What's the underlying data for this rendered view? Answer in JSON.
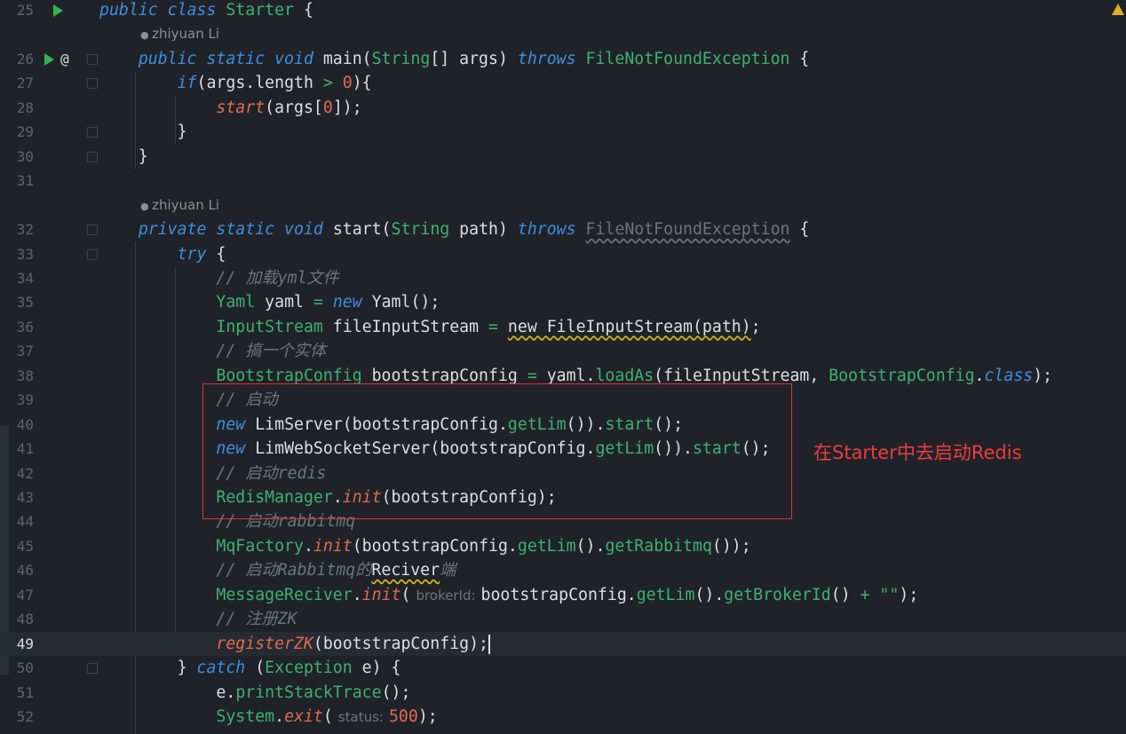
{
  "editor": {
    "author": "zhiyuan Li",
    "annotation": "在Starter中去启动Redis",
    "current_line": "49",
    "rows": [
      {
        "ln": "25",
        "run": true,
        "t": [
          [
            "k",
            "public class "
          ],
          [
            "c",
            "Starter"
          ],
          [
            "p",
            " {"
          ]
        ]
      },
      {
        "author": true
      },
      {
        "ln": "26",
        "run": true,
        "at": true,
        "fold": true,
        "t": [
          [
            "p",
            "    "
          ],
          [
            "k",
            "public static void "
          ],
          [
            "p",
            "main("
          ],
          [
            "c",
            "String"
          ],
          [
            "p",
            "[] args) "
          ],
          [
            "k",
            "throws "
          ],
          [
            "c",
            "FileNotFoundException"
          ],
          [
            "p",
            " {"
          ]
        ]
      },
      {
        "ln": "27",
        "fold": true,
        "t": [
          [
            "p",
            "        "
          ],
          [
            "k",
            "if"
          ],
          [
            "p",
            "(args.length "
          ],
          [
            "o",
            ">"
          ],
          [
            "p",
            " "
          ],
          [
            "n",
            "0"
          ],
          [
            "p",
            "){"
          ]
        ]
      },
      {
        "ln": "28",
        "t": [
          [
            "p",
            "            "
          ],
          [
            "s",
            "start"
          ],
          [
            "p",
            "(args["
          ],
          [
            "n",
            "0"
          ],
          [
            "p",
            "]);"
          ]
        ]
      },
      {
        "ln": "29",
        "fold": true,
        "t": [
          [
            "p",
            "        }"
          ]
        ]
      },
      {
        "ln": "30",
        "fold": true,
        "t": [
          [
            "p",
            "    }"
          ]
        ]
      },
      {
        "ln": "31",
        "t": []
      },
      {
        "author": true
      },
      {
        "ln": "32",
        "fold": true,
        "t": [
          [
            "p",
            "    "
          ],
          [
            "k",
            "private static void "
          ],
          [
            "p",
            "start("
          ],
          [
            "c",
            "String"
          ],
          [
            "p",
            " path) "
          ],
          [
            "k",
            "throws "
          ],
          [
            "dim",
            "FileNotFoundException"
          ],
          [
            "p",
            " {"
          ]
        ]
      },
      {
        "ln": "33",
        "fold": true,
        "t": [
          [
            "p",
            "        "
          ],
          [
            "k",
            "try"
          ],
          [
            "p",
            " {"
          ]
        ]
      },
      {
        "ln": "34",
        "t": [
          [
            "p",
            "            "
          ],
          [
            "cm",
            "// 加载yml文件"
          ]
        ]
      },
      {
        "ln": "35",
        "t": [
          [
            "p",
            "            "
          ],
          [
            "c",
            "Yaml"
          ],
          [
            "p",
            " yaml "
          ],
          [
            "o",
            "="
          ],
          [
            "p",
            " "
          ],
          [
            "k",
            "new "
          ],
          [
            "p",
            "Yaml();"
          ]
        ]
      },
      {
        "ln": "36",
        "t": [
          [
            "p",
            "            "
          ],
          [
            "c",
            "InputStream"
          ],
          [
            "p",
            " fileInputStream "
          ],
          [
            "o",
            "="
          ],
          [
            "p",
            " "
          ],
          [
            "warn",
            "new FileInputStream(path)"
          ],
          [
            "p",
            ";"
          ]
        ]
      },
      {
        "ln": "37",
        "t": [
          [
            "p",
            "            "
          ],
          [
            "cm",
            "// 搞一个实体"
          ]
        ]
      },
      {
        "ln": "38",
        "t": [
          [
            "p",
            "            "
          ],
          [
            "c",
            "BootstrapConfig"
          ],
          [
            "p",
            " bootstrapConfig "
          ],
          [
            "o",
            "="
          ],
          [
            "p",
            " yaml."
          ],
          [
            "m",
            "loadAs"
          ],
          [
            "p",
            "(fileInputStream, "
          ],
          [
            "c",
            "BootstrapConfig"
          ],
          [
            "p",
            "."
          ],
          [
            "k",
            "class"
          ],
          [
            "p",
            ");"
          ]
        ]
      },
      {
        "ln": "39",
        "t": [
          [
            "p",
            "            "
          ],
          [
            "cm",
            "// 启动"
          ]
        ]
      },
      {
        "ln": "40",
        "t": [
          [
            "p",
            "            "
          ],
          [
            "k",
            "new "
          ],
          [
            "p",
            "LimServer(bootstrapConfig."
          ],
          [
            "m",
            "getLim"
          ],
          [
            "p",
            "())."
          ],
          [
            "m",
            "start"
          ],
          [
            "p",
            "();"
          ]
        ]
      },
      {
        "ln": "41",
        "t": [
          [
            "p",
            "            "
          ],
          [
            "k",
            "new "
          ],
          [
            "p",
            "LimWebSocketServer(bootstrapConfig."
          ],
          [
            "m",
            "getLim"
          ],
          [
            "p",
            "())."
          ],
          [
            "m",
            "start"
          ],
          [
            "p",
            "();"
          ]
        ]
      },
      {
        "ln": "42",
        "t": [
          [
            "p",
            "            "
          ],
          [
            "cm",
            "// 启动redis"
          ]
        ]
      },
      {
        "ln": "43",
        "t": [
          [
            "p",
            "            "
          ],
          [
            "c",
            "RedisManager"
          ],
          [
            "p",
            "."
          ],
          [
            "s",
            "init"
          ],
          [
            "p",
            "(bootstrapConfig);"
          ]
        ]
      },
      {
        "ln": "44",
        "t": [
          [
            "p",
            "            "
          ],
          [
            "cm",
            "// 启动rabbitmq"
          ]
        ]
      },
      {
        "ln": "45",
        "t": [
          [
            "p",
            "            "
          ],
          [
            "c",
            "MqFactory"
          ],
          [
            "p",
            "."
          ],
          [
            "s",
            "init"
          ],
          [
            "p",
            "(bootstrapConfig."
          ],
          [
            "m",
            "getLim"
          ],
          [
            "p",
            "()."
          ],
          [
            "m",
            "getRabbitmq"
          ],
          [
            "p",
            "());"
          ]
        ]
      },
      {
        "ln": "46",
        "t": [
          [
            "p",
            "            "
          ],
          [
            "cm",
            "// 启动Rabbitmq的"
          ],
          [
            "warn",
            "Reciver"
          ],
          [
            "cm",
            "端"
          ]
        ]
      },
      {
        "ln": "47",
        "t": [
          [
            "p",
            "            "
          ],
          [
            "c",
            "MessageReciver"
          ],
          [
            "p",
            "."
          ],
          [
            "s",
            "init"
          ],
          [
            "p",
            "("
          ],
          [
            "hint",
            "brokerId:"
          ],
          [
            "p",
            "bootstrapConfig."
          ],
          [
            "m",
            "getLim"
          ],
          [
            "p",
            "()."
          ],
          [
            "m",
            "getBrokerId"
          ],
          [
            "p",
            "() "
          ],
          [
            "o",
            "+"
          ],
          [
            "p",
            " "
          ],
          [
            "c",
            "\"\""
          ],
          [
            "p",
            ");"
          ]
        ]
      },
      {
        "ln": "48",
        "t": [
          [
            "p",
            "            "
          ],
          [
            "cm",
            "// 注册ZK"
          ]
        ]
      },
      {
        "ln": "49",
        "current": true,
        "t": [
          [
            "p",
            "            "
          ],
          [
            "s",
            "registerZK"
          ],
          [
            "p",
            "(bootstrapConfig);"
          ]
        ]
      },
      {
        "ln": "50",
        "fold": true,
        "t": [
          [
            "p",
            "        } "
          ],
          [
            "k",
            "catch "
          ],
          [
            "p",
            "("
          ],
          [
            "c",
            "Exception"
          ],
          [
            "p",
            " e) {"
          ]
        ]
      },
      {
        "ln": "51",
        "t": [
          [
            "p",
            "            e."
          ],
          [
            "m",
            "printStackTrace"
          ],
          [
            "p",
            "();"
          ]
        ]
      },
      {
        "ln": "52",
        "t": [
          [
            "p",
            "            "
          ],
          [
            "c",
            "System"
          ],
          [
            "p",
            "."
          ],
          [
            "s",
            "exit"
          ],
          [
            "p",
            "("
          ],
          [
            "hint",
            "status:"
          ],
          [
            "n",
            "500"
          ],
          [
            "p",
            ");"
          ]
        ]
      }
    ]
  },
  "colors": {
    "background": "#1f2329",
    "keyword": "#3e8ee0",
    "type": "#3fb16f",
    "method": "#e36a4f",
    "comment": "#6d7480",
    "highlight_box": "#e03131"
  }
}
